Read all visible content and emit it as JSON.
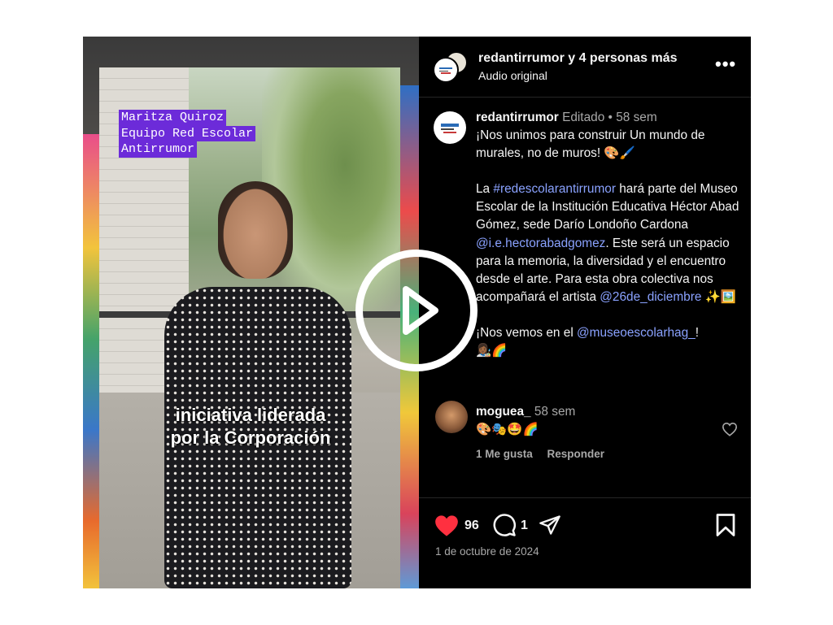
{
  "overlay": {
    "name_lines": [
      "Maritza Quiroz",
      "Equipo Red Escolar",
      "Antirrumor"
    ],
    "caption_lines": [
      "iniciativa liderada",
      "por la Corporación"
    ]
  },
  "header": {
    "title": "redantirrumor y 4 personas más",
    "subtitle": "Audio original",
    "more": "•••"
  },
  "post": {
    "username": "redantirrumor",
    "edited": "Editado",
    "sep": "•",
    "age": "58 sem",
    "line1": "¡Nos unimos para construir Un mundo de murales, no de muros! 🎨🖌️",
    "p2_a": "La ",
    "hashtag": "#redescolarantirrumor",
    "p2_b": " hará parte del Museo Escolar de la Institución Educativa Héctor Abad Gómez, sede Darío Londoño Cardona ",
    "mention1": "@i.e.hectorabadgomez",
    "p2_c": ". Este será un espacio para la memoria, la diversidad y el encuentro desde el arte. Para esta obra colectiva nos acompañará el artista ",
    "mention2": "@26de_diciembre",
    "p2_d": " ✨🖼️",
    "p3_a": "¡Nos vemos en el ",
    "mention3": "@museoescolarhag_",
    "p3_b": "!",
    "p3_emoji": "👩🏾‍🎨🌈"
  },
  "comment": {
    "username": "moguea_",
    "age": "58 sem",
    "text": "🎨🎭🤩🌈",
    "likes": "1 Me gusta",
    "reply": "Responder"
  },
  "actions": {
    "likes": "96",
    "comments": "1",
    "date": "1 de octubre de 2024"
  },
  "colors": {
    "accent_link": "#8aa2ff",
    "like_red": "#ff3040",
    "name_tag_bg": "#6c2bd9"
  }
}
